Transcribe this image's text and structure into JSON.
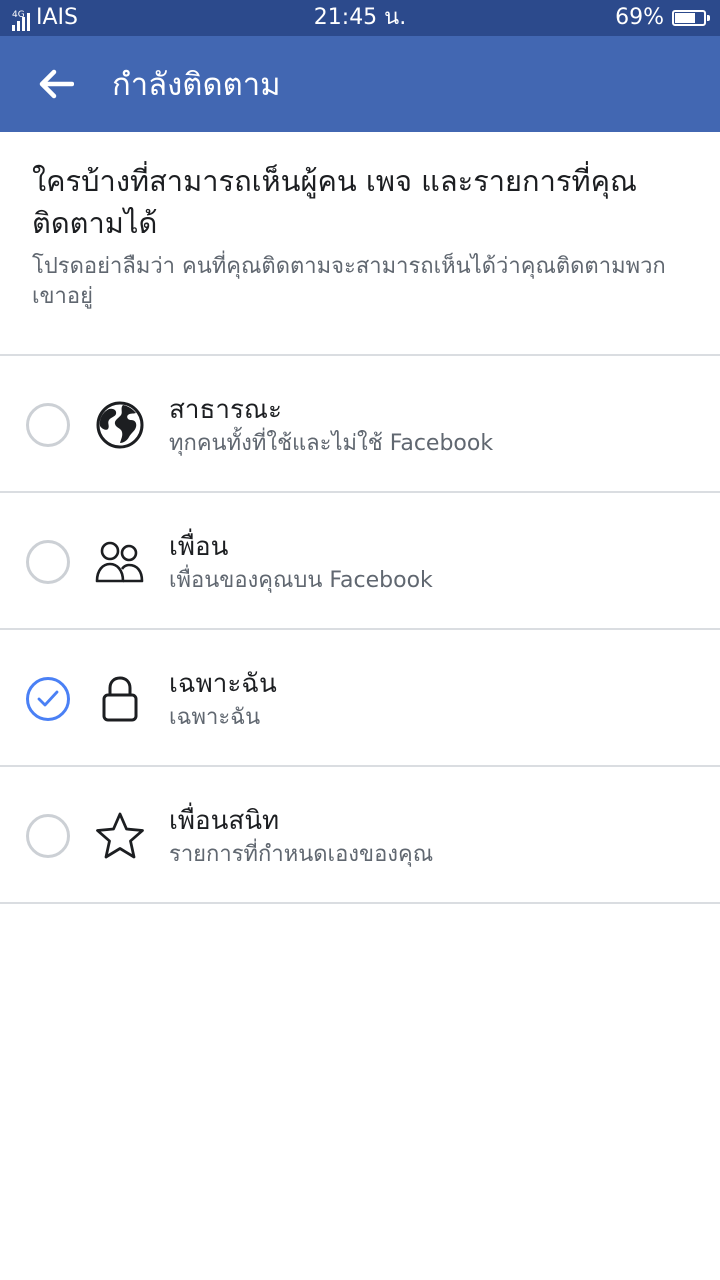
{
  "status_bar": {
    "network": "4G",
    "carrier": "IAIS",
    "time": "21:45 น.",
    "battery": "69%"
  },
  "app_bar": {
    "title": "กำลังติดตาม"
  },
  "intro": {
    "heading": "ใครบ้างที่สามารถเห็นผู้คน เพจ และรายการที่คุณติดตามได้",
    "subtext": "โปรดอย่าลืมว่า คนที่คุณติดตามจะสามารถเห็นได้ว่าคุณติดตามพวกเขาอยู่"
  },
  "options": [
    {
      "label": "สาธารณะ",
      "description": "ทุกคนทั้งที่ใช้และไม่ใช้ Facebook",
      "icon": "globe-icon",
      "selected": false
    },
    {
      "label": "เพื่อน",
      "description": "เพื่อนของคุณบน Facebook",
      "icon": "friends-icon",
      "selected": false
    },
    {
      "label": "เฉพาะฉัน",
      "description": "เฉพาะฉัน",
      "icon": "lock-icon",
      "selected": true
    },
    {
      "label": "เพื่อนสนิท",
      "description": "รายการที่กำหนดเองของคุณ",
      "icon": "star-icon",
      "selected": false
    }
  ],
  "colors": {
    "status_bar": "#2c4a8c",
    "app_bar": "#4267b2",
    "radio_checked": "#4a80f5",
    "radio_unchecked": "#ccd0d5"
  }
}
